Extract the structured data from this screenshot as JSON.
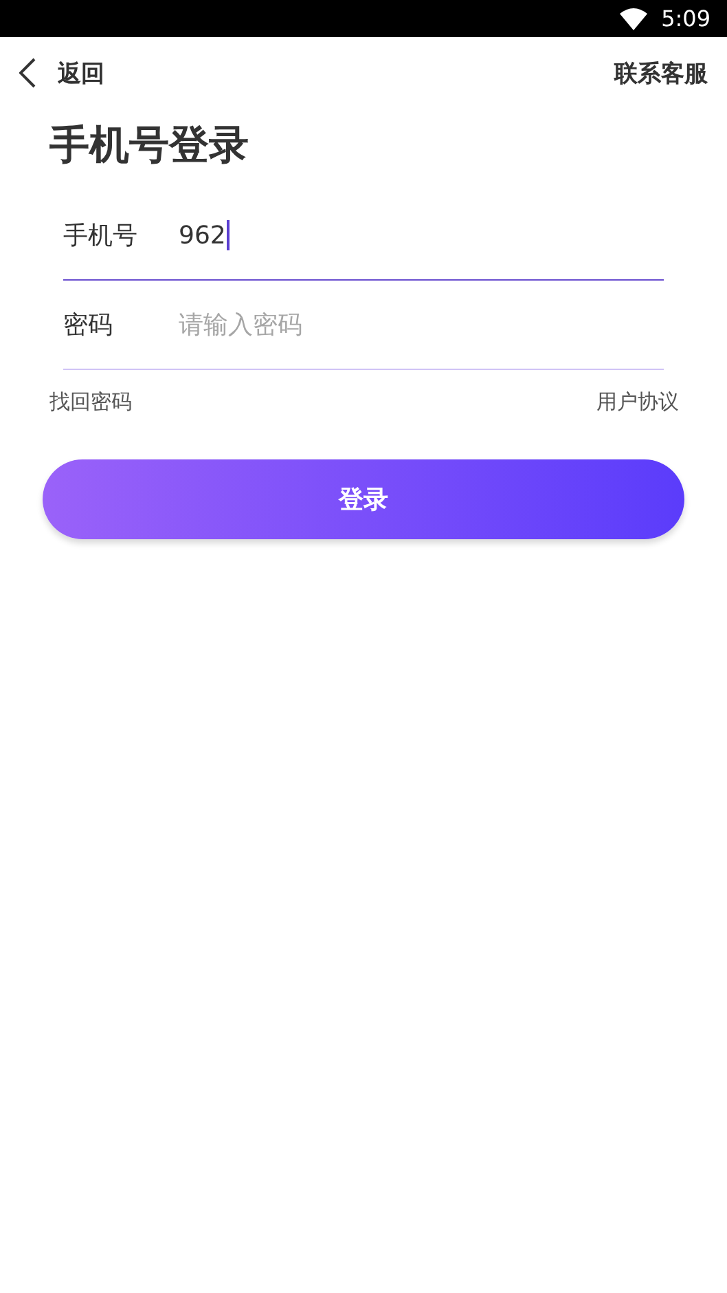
{
  "status_bar": {
    "time": "5:09"
  },
  "nav": {
    "back": "返回",
    "support": "联系客服"
  },
  "title": "手机号登录",
  "fields": [
    {
      "label": "手机号",
      "value": "962",
      "focused": true
    },
    {
      "label": "密码",
      "placeholder": "请输入密码",
      "focused": false
    }
  ],
  "links": {
    "left": "找回密码",
    "right": "用户协议"
  },
  "login_button": "登录"
}
